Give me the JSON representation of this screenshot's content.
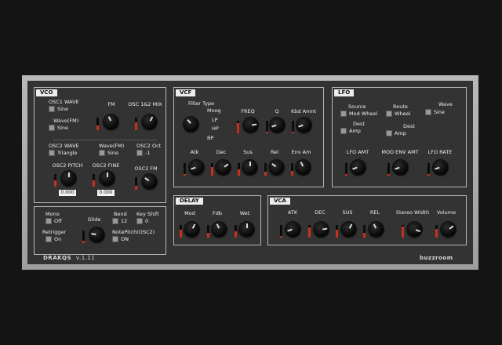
{
  "plugin": {
    "name": "DRAKQS",
    "version": "v.1.11",
    "brand": "buzzroom",
    "accent_color": "#c8301e"
  },
  "vco": {
    "title": "VCO",
    "osc1_wave": {
      "label": "OSC1 WAVE",
      "value": "Sine"
    },
    "wave_fm": {
      "label": "Wave(FM)",
      "value": "Sine"
    },
    "fm_label": "FM",
    "mix_label": "OSC 1&2 MIX",
    "osc2_wave": {
      "label": "OSC2 WAVE",
      "value": "Triangle"
    },
    "osc2_wave_fm": {
      "label": "Wave(FM)",
      "value": "Sine"
    },
    "osc2_oct": {
      "label": "OSC2 Oct",
      "value": "-1"
    },
    "osc2_pitch": {
      "label": "OSC2 PITCH",
      "value": "0.000"
    },
    "osc2_fine": {
      "label": "OSC2 FINE",
      "value": "0.000"
    },
    "osc2_fm_label": "OSC2 FM"
  },
  "global": {
    "mono": {
      "label": "Mono",
      "value": "Off"
    },
    "retrigger": {
      "label": "Retrigger",
      "value": "On"
    },
    "glide_label": "Glide",
    "bend": {
      "label": "Bend",
      "value": "12"
    },
    "key_shift": {
      "label": "Key Shift",
      "value": "0"
    },
    "note_pitch": {
      "label": "NotePitch(OSC2)",
      "value": "ON"
    }
  },
  "vcf": {
    "title": "VCF",
    "filter_type_label": "Filter Type",
    "filter_options": [
      "Moog",
      "LP",
      "HP",
      "BP"
    ],
    "freq_label": "FREQ",
    "q_label": "Q",
    "kbd_amnt_label": "Kbd Amnt",
    "atk_label": "Atk",
    "dec_label": "Dec",
    "sus_label": "Sus",
    "rel_label": "Rel",
    "env_am_label": "Env Am"
  },
  "lfo": {
    "title": "LFO",
    "source": {
      "label": "Source",
      "value": "Mod Wheel"
    },
    "route": {
      "label": "Route",
      "value": "Wheel"
    },
    "wave": {
      "label": "Wave",
      "value": "Sine"
    },
    "dest1": {
      "label": "Dest",
      "value": "Amp"
    },
    "dest2": {
      "label": "Dest",
      "value": "Amp"
    },
    "lfo_amt_label": "LFO AMT",
    "mod_env_amt_label": "MOD ENV AMT",
    "lfo_rate_label": "LFO RATE"
  },
  "delay": {
    "title": "DELAY",
    "mod_label": "Mod",
    "fdb_label": "Fdb",
    "wet_label": "Wet"
  },
  "vca": {
    "title": "VCA",
    "atk_label": "ATK",
    "dec_label": "DEC",
    "sus_label": "SUS",
    "rel_label": "REL",
    "stereo_width_label": "Stereo Width",
    "volume_label": "Volume"
  },
  "levels": {
    "fm": 0.4,
    "mix": 0.6,
    "osc2_pitch": 0.5,
    "osc2_fine": 0.5,
    "osc2_fm": 0.3,
    "glide": 0.2,
    "freq": 0.8,
    "q": 0.1,
    "kbd": 0.1,
    "vcf_atk": 0.1,
    "vcf_dec": 0.7,
    "vcf_sus": 0.5,
    "vcf_rel": 0.3,
    "vcf_env": 0.4,
    "delay_mod": 0.6,
    "delay_fdb": 0.4,
    "delay_wet": 0.5,
    "vca_atk": 0.1,
    "vca_dec": 0.8,
    "vca_sus": 0.6,
    "vca_rel": 0.4,
    "stereo_width": 0.9,
    "volume": 0.7,
    "lfo_amt": 0.1,
    "mod_env": 0.1,
    "lfo_rate": 0.1
  }
}
